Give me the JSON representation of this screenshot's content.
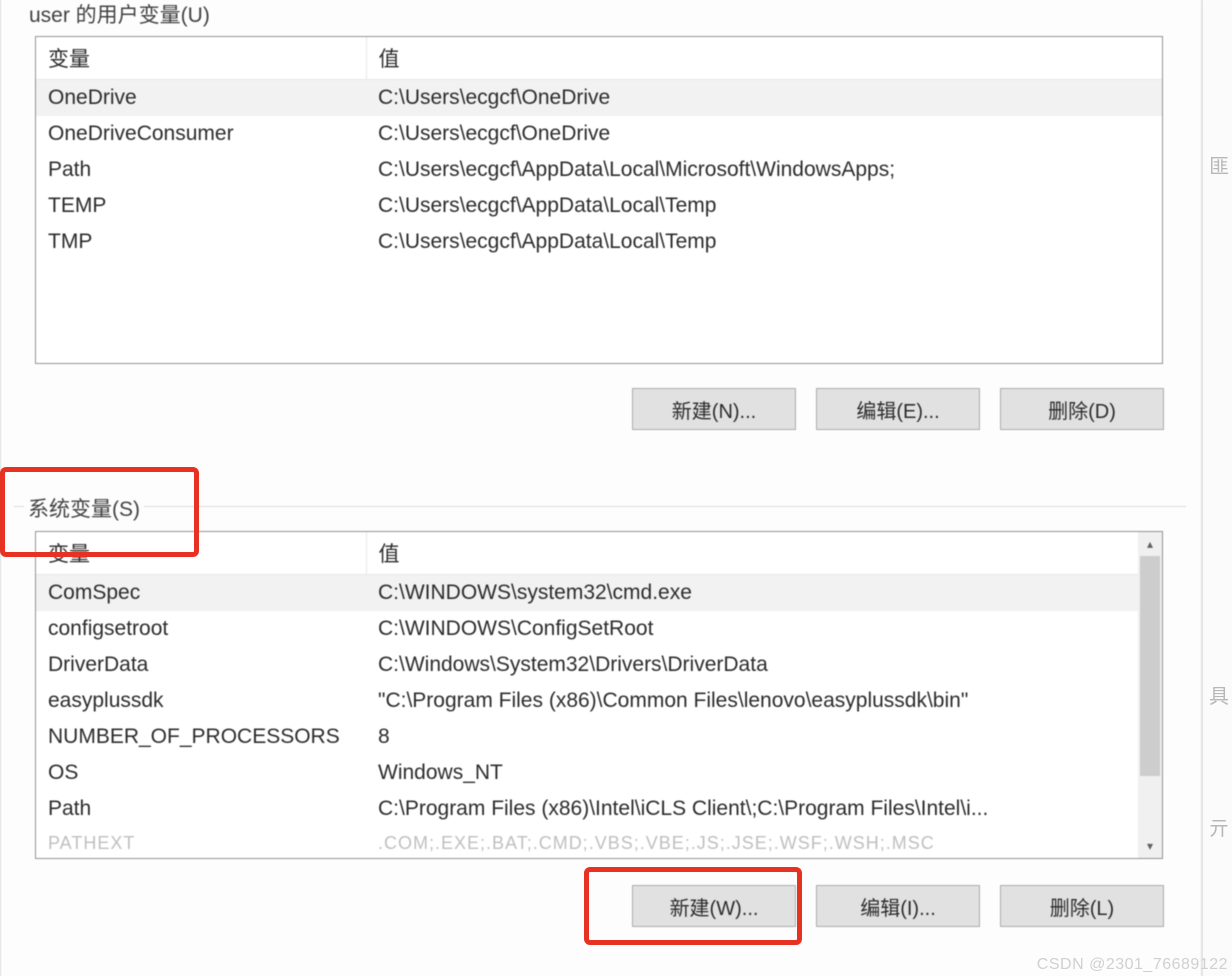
{
  "user_vars": {
    "group_label": "user 的用户变量(U)",
    "columns": {
      "name": "变量",
      "value": "值"
    },
    "rows": [
      {
        "name": "OneDrive",
        "value": "C:\\Users\\ecgcf\\OneDrive",
        "selected": true
      },
      {
        "name": "OneDriveConsumer",
        "value": "C:\\Users\\ecgcf\\OneDrive"
      },
      {
        "name": "Path",
        "value": "C:\\Users\\ecgcf\\AppData\\Local\\Microsoft\\WindowsApps;"
      },
      {
        "name": "TEMP",
        "value": "C:\\Users\\ecgcf\\AppData\\Local\\Temp"
      },
      {
        "name": "TMP",
        "value": "C:\\Users\\ecgcf\\AppData\\Local\\Temp"
      }
    ],
    "buttons": {
      "new": "新建(N)...",
      "edit": "编辑(E)...",
      "delete": "删除(D)"
    }
  },
  "system_vars": {
    "group_label": "系统变量(S)",
    "columns": {
      "name": "变量",
      "value": "值"
    },
    "rows": [
      {
        "name": "ComSpec",
        "value": "C:\\WINDOWS\\system32\\cmd.exe",
        "selected": true
      },
      {
        "name": "configsetroot",
        "value": "C:\\WINDOWS\\ConfigSetRoot"
      },
      {
        "name": "DriverData",
        "value": "C:\\Windows\\System32\\Drivers\\DriverData"
      },
      {
        "name": "easyplussdk",
        "value": "\"C:\\Program Files (x86)\\Common Files\\lenovo\\easyplussdk\\bin\""
      },
      {
        "name": "NUMBER_OF_PROCESSORS",
        "value": "8"
      },
      {
        "name": "OS",
        "value": "Windows_NT"
      },
      {
        "name": "Path",
        "value": "C:\\Program Files (x86)\\Intel\\iCLS Client\\;C:\\Program Files\\Intel\\i..."
      }
    ],
    "cutoff_row": {
      "name": "PATHEXT",
      "value": ".COM;.EXE;.BAT;.CMD;.VBS;.VBE;.JS;.JSE;.WSF;.WSH;.MSC"
    },
    "buttons": {
      "new": "新建(W)...",
      "edit": "编辑(I)...",
      "delete": "删除(L)"
    }
  },
  "watermark": "CSDN @2301_76689122"
}
